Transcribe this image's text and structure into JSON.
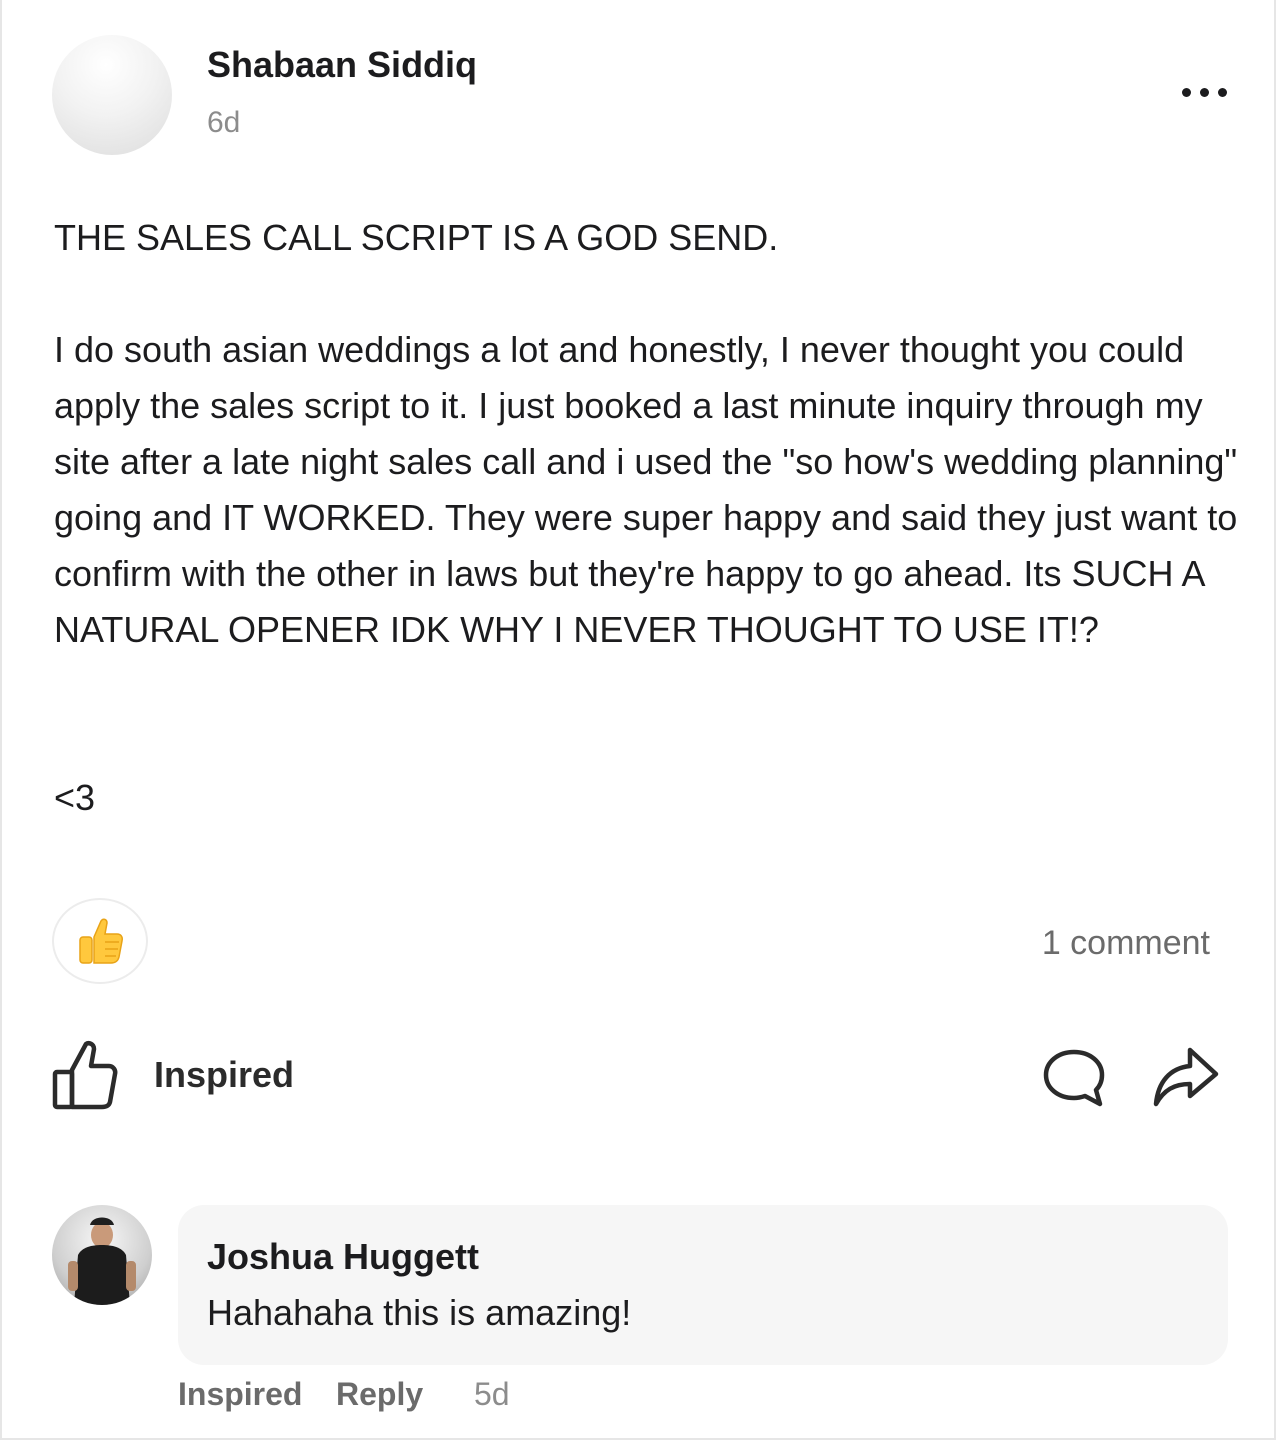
{
  "post": {
    "author": "Shabaan Siddiq",
    "time": "6d",
    "body": "THE SALES CALL SCRIPT IS A GOD SEND.\n\nI do south asian weddings a lot and honestly, I never thought you could apply the sales script to it. I just booked a last minute inquiry through my site after a late night sales call and i used the \"so how's wedding planning\" going and IT WORKED. They were super happy and said they just want to confirm with the other in laws but they're happy to go ahead. Its SUCH A NATURAL OPENER IDK WHY I NEVER THOUGHT TO USE IT!?\n\n\n<3",
    "reaction_emoji": "👍",
    "comment_count": "1 comment"
  },
  "actions": {
    "like_label": "Inspired"
  },
  "comment": {
    "author": "Joshua Huggett",
    "text": "Hahahaha this is amazing!",
    "inspired_label": "Inspired",
    "reply_label": "Reply",
    "time": "5d"
  },
  "icons": {
    "more": "more-horizontal-icon",
    "reaction": "thumbs-up-emoji-icon",
    "like": "thumbs-up-outline-icon",
    "comment": "comment-bubble-icon",
    "share": "share-arrow-icon"
  },
  "colors": {
    "text": "#1c1c1e",
    "muted": "#8c8c8c",
    "bubble": "#f6f6f6",
    "emoji": "#ffc83d"
  }
}
